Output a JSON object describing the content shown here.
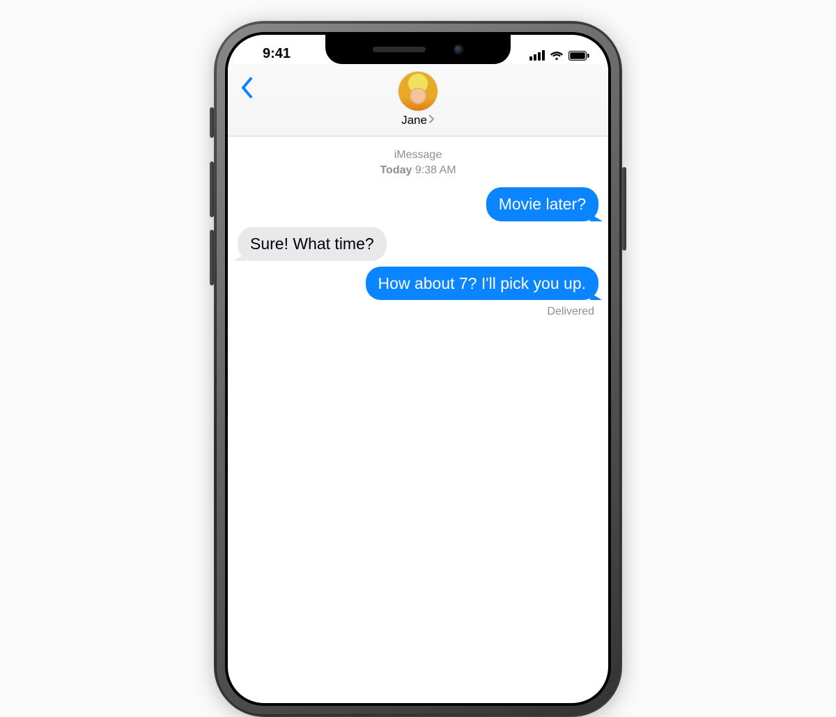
{
  "status_bar": {
    "time": "9:41"
  },
  "header": {
    "contact_name": "Jane"
  },
  "thread": {
    "service_label": "iMessage",
    "meta_day": "Today",
    "meta_time": "9:38 AM",
    "messages": [
      {
        "direction": "sent",
        "text": "Movie later?"
      },
      {
        "direction": "recv",
        "text": "Sure! What time?"
      },
      {
        "direction": "sent",
        "text": "How about 7? I'll pick you up."
      }
    ],
    "delivery_status": "Delivered"
  },
  "colors": {
    "sent_bubble": "#0a84ff",
    "recv_bubble": "#e9e9eb",
    "meta_text": "#8e8e93",
    "accent": "#0a84ff"
  }
}
